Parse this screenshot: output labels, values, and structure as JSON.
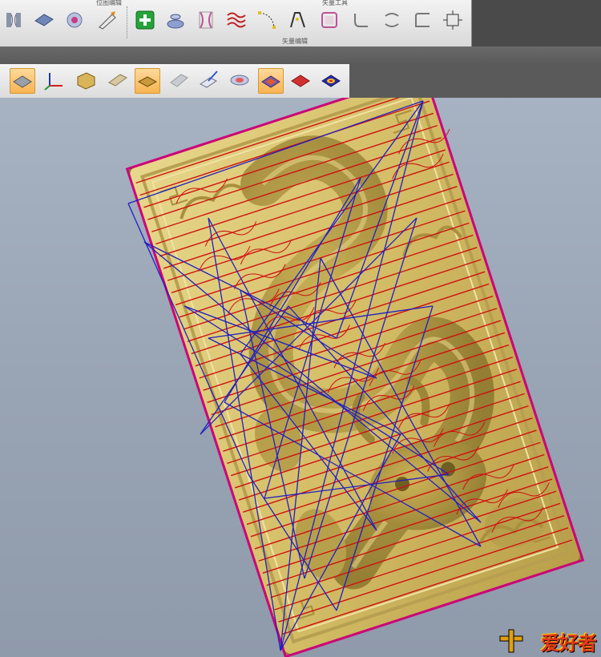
{
  "toolbar_top": {
    "group_left_label": "位图编辑",
    "group_middle_label": "矢量编辑",
    "group_right_label": "矢量工具"
  },
  "toolbar_view": {
    "active_buttons": [
      "shaded-view",
      "wireframe-view",
      "color-relief-view"
    ]
  },
  "watermark": {
    "text": "爱好者"
  },
  "colors": {
    "relief": "#d8c26e",
    "toolpath_red": "#d01010",
    "toolpath_blue": "#2020c0",
    "boundary_magenta": "#cc0077",
    "background": "#9aa4b3"
  }
}
